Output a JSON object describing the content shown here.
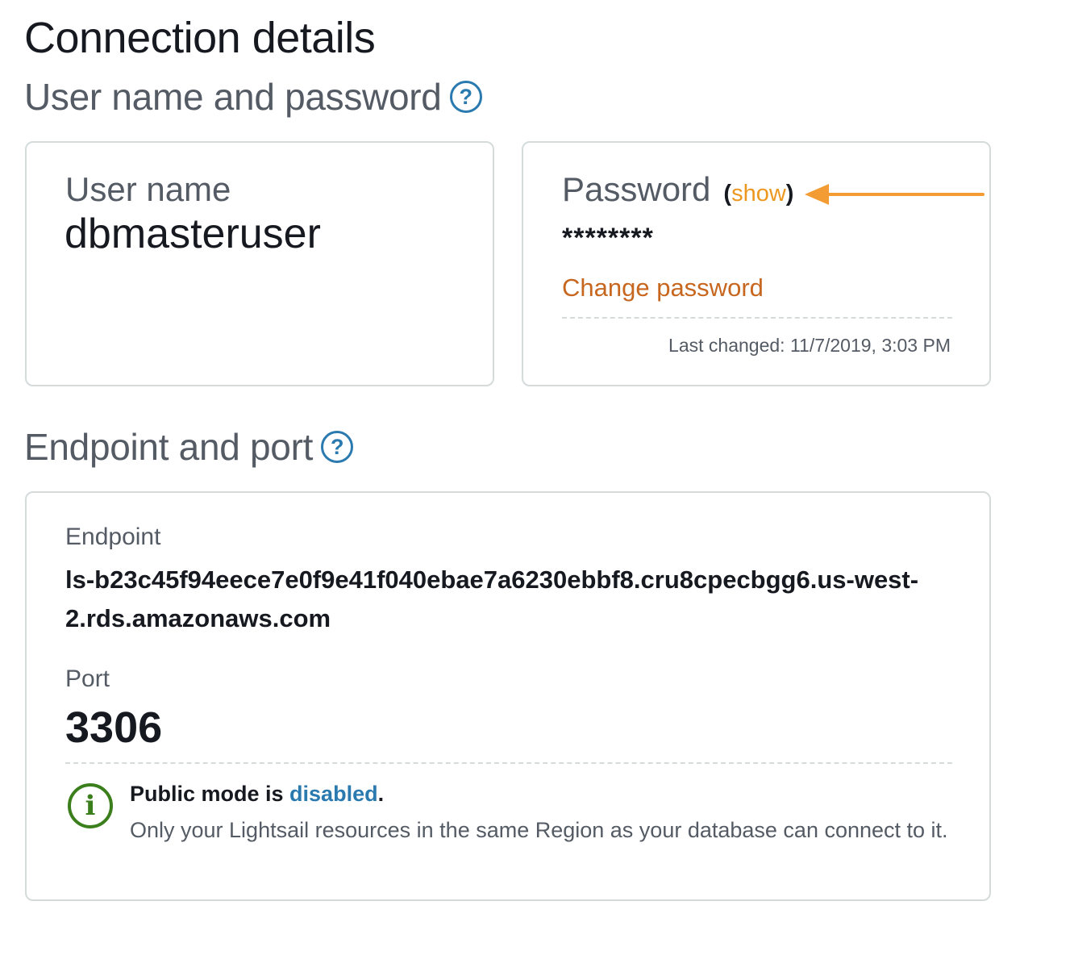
{
  "page": {
    "title": "Connection details"
  },
  "credentials": {
    "section_title": "User name and password",
    "help_icon": "?",
    "user_name_label": "User name",
    "user_name_value": "dbmasteruser",
    "password_label": "Password",
    "show_open": "(",
    "show_link": "show",
    "show_close": ")",
    "password_masked": "********",
    "change_password_link": "Change password",
    "last_changed": "Last changed: 11/7/2019, 3:03 PM"
  },
  "endpoint_section": {
    "section_title": "Endpoint and port",
    "help_icon": "?",
    "endpoint_label": "Endpoint",
    "endpoint_value": "ls-b23c45f94eece7e0f9e41f040ebae7a6230ebbf8.cru8cpecbgg6.us-west-2.rds.amazonaws.com",
    "port_label": "Port",
    "port_value": "3306",
    "notice_icon": "i",
    "notice_prefix": "Public mode is ",
    "notice_status": "disabled",
    "notice_suffix": ".",
    "notice_description": "Only your Lightsail resources in the same Region as your database can connect to it."
  },
  "colors": {
    "link_blue": "#2a7ab0",
    "link_orange": "#c7671f",
    "show_orange": "#ec971f",
    "annotation_arrow": "#f39c33",
    "info_green": "#3b7f1d"
  }
}
